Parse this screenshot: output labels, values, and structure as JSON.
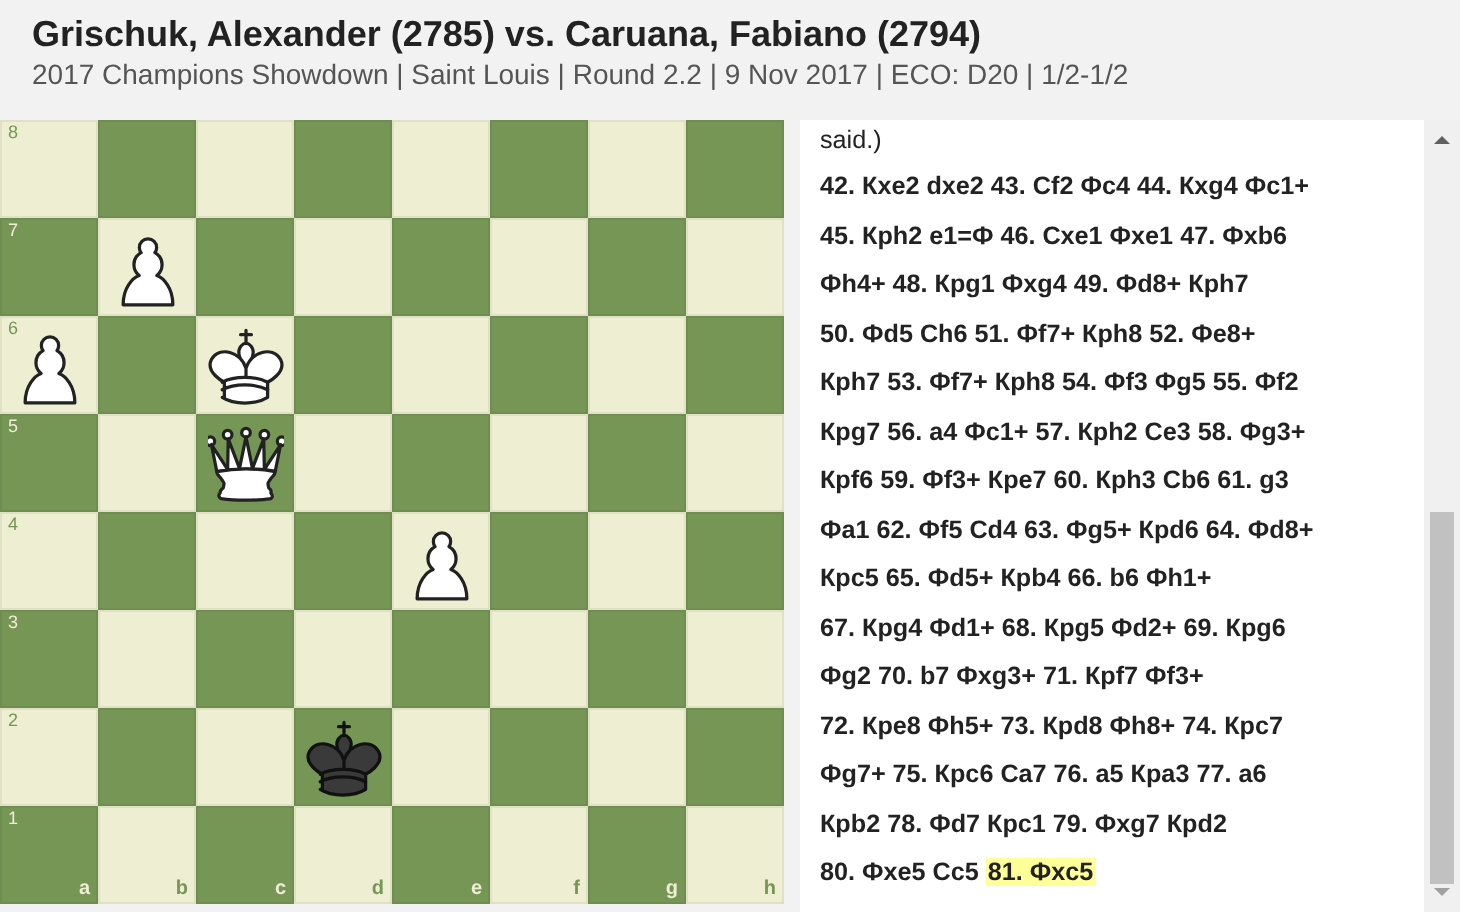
{
  "game": {
    "title": "Grischuk, Alexander (2785) vs. Caruana, Fabiano (2794)",
    "subtitle": "2017 Champions Showdown | Saint Louis | Round 2.2 | 9 Nov 2017 | ECO: D20 | 1/2-1/2"
  },
  "board": {
    "files": [
      "a",
      "b",
      "c",
      "d",
      "e",
      "f",
      "g",
      "h"
    ],
    "ranks": [
      {
        "label": "8",
        "squares": [
          {
            "kind": "empty"
          },
          {
            "kind": "empty"
          },
          {
            "kind": "empty"
          },
          {
            "kind": "empty"
          },
          {
            "kind": "empty"
          },
          {
            "kind": "empty"
          },
          {
            "kind": "empty"
          },
          {
            "kind": "empty"
          }
        ]
      },
      {
        "label": "7",
        "squares": [
          {
            "kind": "empty"
          },
          {
            "kind": "pawn",
            "white": true
          },
          {
            "kind": "empty"
          },
          {
            "kind": "empty"
          },
          {
            "kind": "empty"
          },
          {
            "kind": "empty"
          },
          {
            "kind": "empty"
          },
          {
            "kind": "empty"
          }
        ]
      },
      {
        "label": "6",
        "squares": [
          {
            "kind": "pawn",
            "white": true
          },
          {
            "kind": "empty"
          },
          {
            "kind": "king",
            "white": true
          },
          {
            "kind": "empty"
          },
          {
            "kind": "empty"
          },
          {
            "kind": "empty"
          },
          {
            "kind": "empty"
          },
          {
            "kind": "empty"
          }
        ]
      },
      {
        "label": "5",
        "squares": [
          {
            "kind": "empty"
          },
          {
            "kind": "empty"
          },
          {
            "kind": "queen",
            "white": true
          },
          {
            "kind": "empty"
          },
          {
            "kind": "empty"
          },
          {
            "kind": "empty"
          },
          {
            "kind": "empty"
          },
          {
            "kind": "empty"
          }
        ]
      },
      {
        "label": "4",
        "squares": [
          {
            "kind": "empty"
          },
          {
            "kind": "empty"
          },
          {
            "kind": "empty"
          },
          {
            "kind": "empty"
          },
          {
            "kind": "pawn",
            "white": true
          },
          {
            "kind": "empty"
          },
          {
            "kind": "empty"
          },
          {
            "kind": "empty"
          }
        ]
      },
      {
        "label": "3",
        "squares": [
          {
            "kind": "empty"
          },
          {
            "kind": "empty"
          },
          {
            "kind": "empty"
          },
          {
            "kind": "empty"
          },
          {
            "kind": "empty"
          },
          {
            "kind": "empty"
          },
          {
            "kind": "empty"
          },
          {
            "kind": "empty"
          }
        ]
      },
      {
        "label": "2",
        "squares": [
          {
            "kind": "empty"
          },
          {
            "kind": "empty"
          },
          {
            "kind": "empty"
          },
          {
            "kind": "king",
            "white": false
          },
          {
            "kind": "empty"
          },
          {
            "kind": "empty"
          },
          {
            "kind": "empty"
          },
          {
            "kind": "empty"
          }
        ]
      },
      {
        "label": "1",
        "squares": [
          {
            "kind": "empty"
          },
          {
            "kind": "empty"
          },
          {
            "kind": "empty"
          },
          {
            "kind": "empty"
          },
          {
            "kind": "empty"
          },
          {
            "kind": "empty"
          },
          {
            "kind": "empty"
          },
          {
            "kind": "empty"
          }
        ]
      }
    ]
  },
  "moves": {
    "lines": [
      "said.)",
      "42. Кxe2 dxe2 43. Сf2 Фc4 44. Кxg4 Фc1+",
      "45. Крh2 e1=Ф 46. Сxe1 Фxe1 47. Фxb6",
      "Фh4+ 48. Крg1 Фxg4 49. Фd8+ Крh7",
      "50. Фd5 Сh6 51. Фf7+ Крh8 52. Фe8+",
      "Крh7 53. Фf7+ Крh8 54. Фf3 Фg5 55. Фf2",
      "Крg7 56. a4 Фc1+ 57. Крh2 Сe3 58. Фg3+",
      "Крf6 59. Фf3+ Крe7 60. Крh3 Сb6 61. g3",
      "Фa1 62. Фf5 Сd4 63. Фg5+ Крd6 64. Фd8+",
      "Крc5 65. Фd5+ Крb4 66. b6 Фh1+",
      "67. Крg4 Фd1+ 68. Крg5 Фd2+ 69. Крg6",
      "Фg2 70. b7 Фxg3+ 71. Крf7 Фf3+",
      "72. Крe8 Фh5+ 73. Крd8 Фh8+ 74. Крc7",
      "Фg7+ 75. Крc6 Сa7 76. a5 Крa3 77. a6",
      "Крb2 78. Фd7 Крc1 79. Фxg7 Крd2",
      "80. Фxe5 Сc5"
    ],
    "current_move": {
      "text": "81. Фxc5",
      "selected": true
    }
  }
}
